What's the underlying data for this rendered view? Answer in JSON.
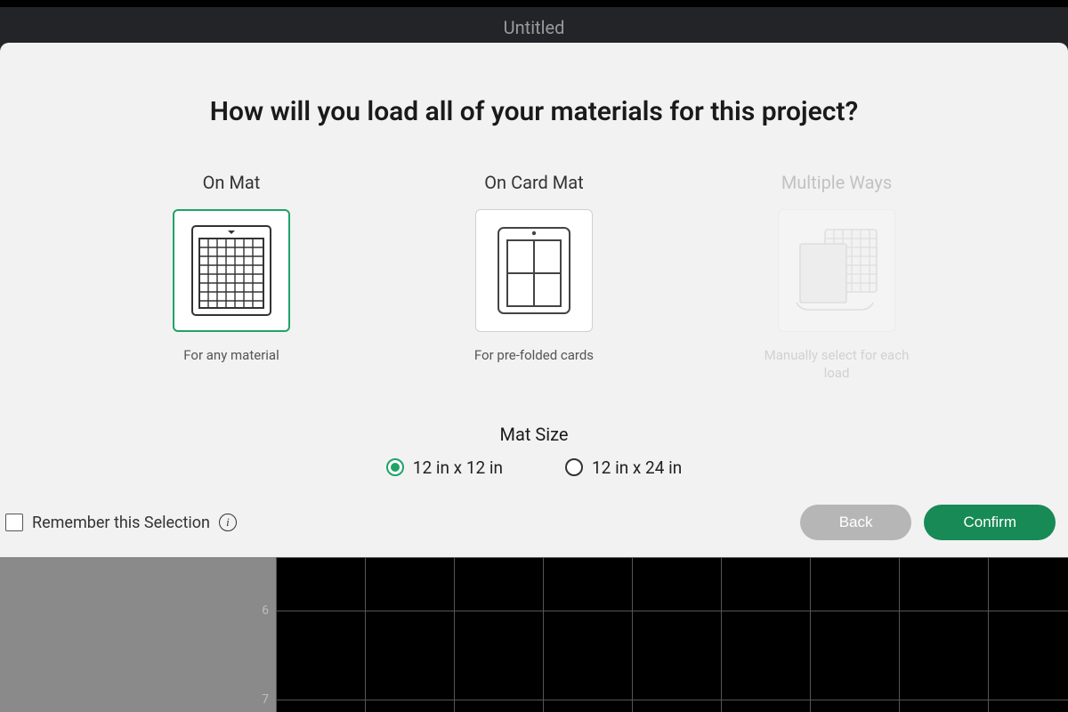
{
  "header": {
    "title": "Untitled"
  },
  "modal": {
    "question": "How will you load all of your materials for this project?",
    "options": [
      {
        "key": "on-mat",
        "title": "On Mat",
        "desc": "For any material",
        "selected": true,
        "disabled": false
      },
      {
        "key": "on-card-mat",
        "title": "On Card Mat",
        "desc": "For pre-folded cards",
        "selected": false,
        "disabled": false
      },
      {
        "key": "multiple-ways",
        "title": "Multiple Ways",
        "desc": "Manually select for each load",
        "selected": false,
        "disabled": true
      }
    ],
    "mat_size": {
      "label": "Mat Size",
      "choices": [
        {
          "key": "12x12",
          "label": "12 in x 12 in",
          "selected": true
        },
        {
          "key": "12x24",
          "label": "12 in x 24 in",
          "selected": false
        }
      ]
    },
    "remember_label": "Remember this Selection",
    "back_label": "Back",
    "confirm_label": "Confirm"
  },
  "canvas": {
    "ruler_marks": [
      "6",
      "7"
    ]
  },
  "colors": {
    "accent": "#1fa366",
    "confirm": "#188a55"
  }
}
